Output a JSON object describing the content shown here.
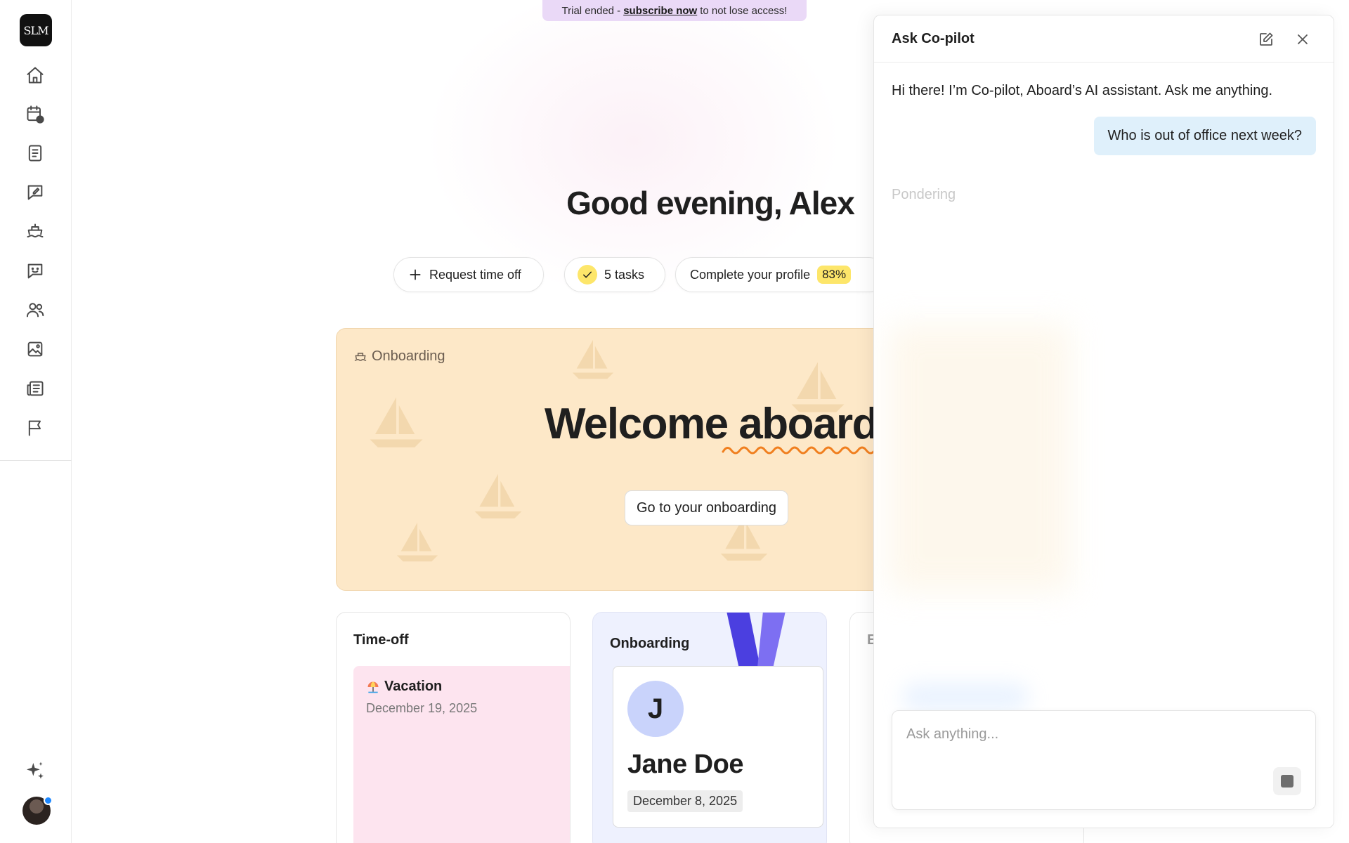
{
  "banner": {
    "prefix": "Trial ended -",
    "link": "subscribe now",
    "suffix": "to not lose access!"
  },
  "sidebar": {
    "logo_text": "SLM",
    "items": [
      {
        "name": "home-icon"
      },
      {
        "name": "calendar-clock-icon"
      },
      {
        "name": "book-icon"
      },
      {
        "name": "feedback-edit-icon"
      },
      {
        "name": "ship-icon"
      },
      {
        "name": "chat-smile-icon"
      },
      {
        "name": "people-icon"
      },
      {
        "name": "image-icon"
      },
      {
        "name": "newspaper-icon"
      },
      {
        "name": "flag-icon"
      }
    ]
  },
  "main": {
    "greeting": "Good evening, Alex",
    "chips": {
      "request_time_off": "Request time off",
      "tasks": "5 tasks",
      "profile": "Complete your profile",
      "profile_pct": "83%"
    },
    "onboarding_hero": {
      "label": "Onboarding",
      "welcome": "Welcome aboard",
      "button": "Go to your onboarding"
    },
    "cards": {
      "timeoff": {
        "title": "Time-off",
        "type": "Vacation",
        "date": "December 19, 2025"
      },
      "onboarding": {
        "title": "Onboarding",
        "initial": "J",
        "name": "Jane Doe",
        "date": "December 8, 2025"
      },
      "third": {
        "title": "E"
      }
    }
  },
  "copilot": {
    "title": "Ask Co-pilot",
    "greeting": "Hi there! I’m Co-pilot, Aboard’s AI assistant. Ask me anything.",
    "user_message": "Who is out of office next week?",
    "status": "Pondering",
    "input_placeholder": "Ask anything..."
  },
  "colors": {
    "accent_yellow": "#fde66a",
    "hero_bg": "#fde8c8",
    "user_bubble": "#dff0fb",
    "avatar_dot": "#1e88ff"
  }
}
